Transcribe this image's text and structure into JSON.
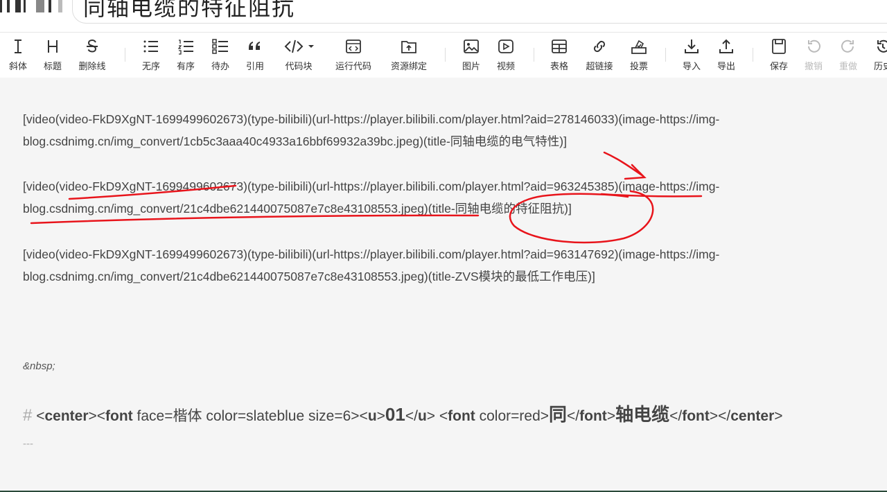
{
  "header": {
    "title_text": "同轴电缆的特征阻抗"
  },
  "toolbar": {
    "italic": "斜体",
    "heading": "标题",
    "strike": "删除线",
    "ul": "无序",
    "ol": "有序",
    "todo": "待办",
    "quote": "引用",
    "codeblock": "代码块",
    "run": "运行代码",
    "resource": "资源绑定",
    "image": "图片",
    "video": "视频",
    "table": "表格",
    "link": "超链接",
    "vote": "投票",
    "import": "导入",
    "export": "导出",
    "save": "保存",
    "undo": "撤销",
    "redo": "重做",
    "history": "历史"
  },
  "editor": {
    "line1": "[video(video-FkD9XgNT-1699499602673)(type-bilibili)(url-https://player.bilibili.com/player.html?aid=278146033)(image-https://img-blog.csdnimg.cn/img_convert/1cb5c3aaa40c4933a16bbf69932a39bc.jpeg)(title-同轴电缆的电气特性)]",
    "line2": "[video(video-FkD9XgNT-1699499602673)(type-bilibili)(url-https://player.bilibili.com/player.html?aid=963245385)(image-https://img-blog.csdnimg.cn/img_convert/21c4dbe621440075087e7c8e43108553.jpeg)(title-同轴电缆的特征阻抗)]",
    "line3": "[video(video-FkD9XgNT-1699499602673)(type-bilibili)(url-https://player.bilibili.com/player.html?aid=963147692)(image-https://img-blog.csdnimg.cn/img_convert/21c4dbe621440075087e7c8e43108553.jpeg)(title-ZVS模块的最低工作电压)]",
    "nbsp": "&nbsp;",
    "heading": {
      "hash": "#",
      "p1": "<",
      "center_open": "center",
      "p2": "><",
      "font_open": "font",
      "attrs1": "  face=楷体 color=slateblue size=6><",
      "u_open": "u",
      "p3": ">",
      "num": "01",
      "p4": "</",
      "u_close": "u",
      "p5": ">  <",
      "font2": "font",
      "attrs2": " color=red>",
      "tong": "同",
      "p6": "</",
      "font_close": "font",
      "p7": ">",
      "rest": "轴电缆",
      "p8": "</",
      "font_close2": "font",
      "p9": "></",
      "center_close": "center",
      "p10": ">"
    },
    "hr": "---"
  },
  "colors": {
    "annotation": "#e8141b",
    "text": "#444444",
    "toolbar_icon": "#333333",
    "disabled": "#bbbbbb"
  }
}
